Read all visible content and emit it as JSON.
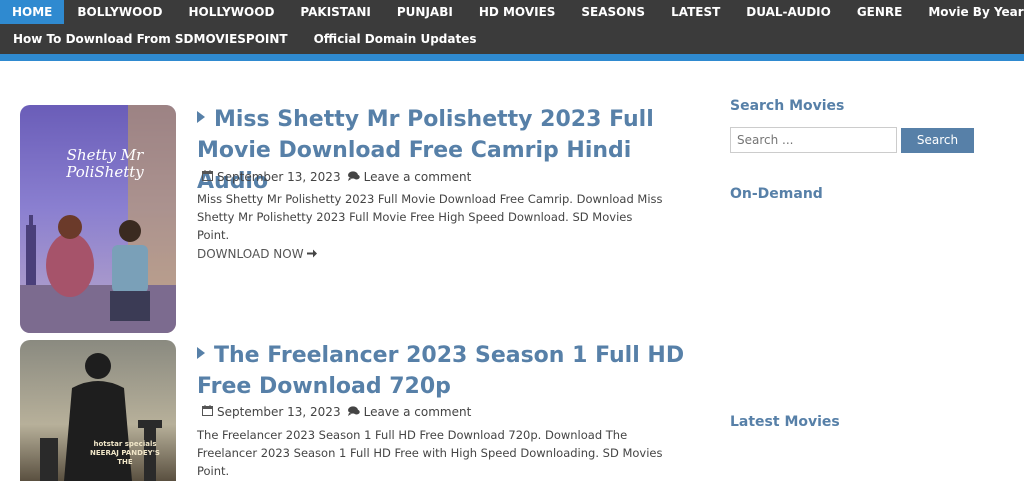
{
  "nav": {
    "row1": [
      "HOME",
      "BOLLYWOOD",
      "HOLLYWOOD",
      "PAKISTANI",
      "PUNJABI",
      "HD MOVIES",
      "SEASONS",
      "LATEST",
      "DUAL-AUDIO",
      "GENRE",
      "Movie By Year"
    ],
    "row2": [
      "How To Download From SDMOVIESPOINT",
      "Official Domain Updates"
    ],
    "active": "HOME",
    "accent_color": "#2f8ad0",
    "bar_color": "#3b3b3b"
  },
  "posts": [
    {
      "title": "Miss Shetty Mr Polishetty 2023 Full Movie Download Free Camrip Hindi Audio",
      "date": "September 13, 2023",
      "comment": "Leave a comment",
      "excerpt": "Miss Shetty Mr Polishetty 2023 Full Movie Download Free Camrip. Download Miss Shetty Mr Polishetty 2023 Full Movie Free High Speed Download. SD Movies Point.",
      "download": "DOWNLOAD NOW",
      "poster_text": "Shetty Mr PoliShetty"
    },
    {
      "title": "The Freelancer 2023 Season 1 Full HD Free Download 720p",
      "date": "September 13, 2023",
      "comment": "Leave a comment",
      "excerpt": "The Freelancer 2023 Season 1 Full HD Free Download 720p. Download The Freelancer 2023 Season 1 Full HD Free with High Speed Downloading. SD Movies Point.",
      "poster_text": "hotstar specials NEERAJ PANDEY'S THE"
    }
  ],
  "sidebar": {
    "search_heading": "Search Movies",
    "search_placeholder": "Search ...",
    "search_button": "Search",
    "ondemand_heading": "On-Demand",
    "latest_heading": "Latest Movies"
  },
  "colors": {
    "title": "#5780a8",
    "button": "#5780a8"
  }
}
